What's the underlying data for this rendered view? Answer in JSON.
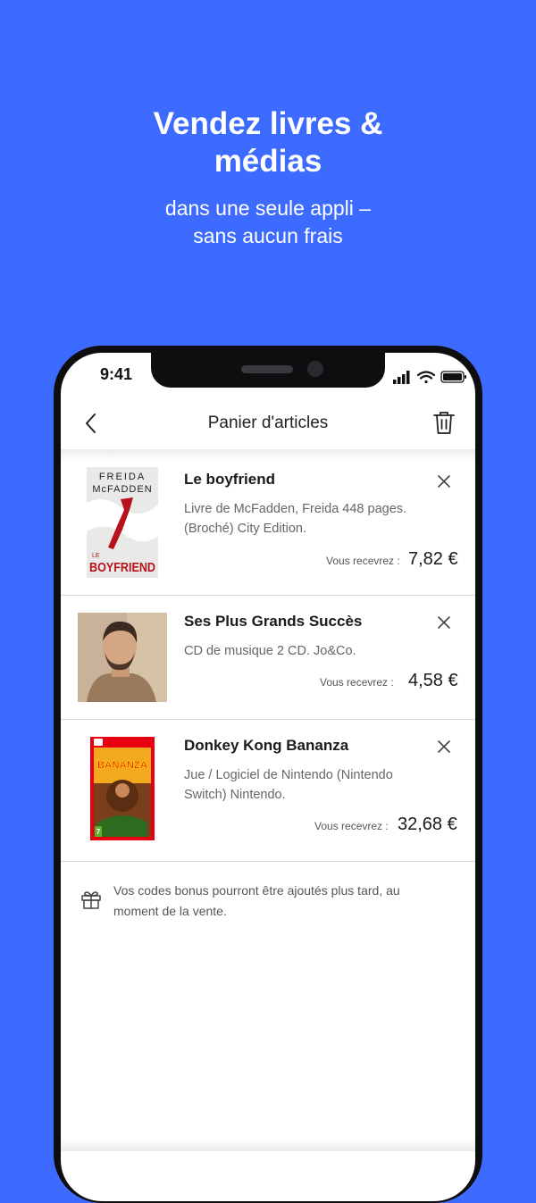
{
  "hero": {
    "title_line1": "Vendez livres &",
    "title_line2": "médias",
    "subtitle_line1": "dans une seule appli –",
    "subtitle_line2": "sans aucun frais"
  },
  "status_bar": {
    "time": "9:41"
  },
  "nav": {
    "title": "Panier d'articles"
  },
  "cart": {
    "receive_label": "Vous recevrez :",
    "items": [
      {
        "title": "Le boyfriend",
        "description": "Livre de McFadden, Freida 448 pages. (Broché) City Edition.",
        "price": "7,82 €",
        "cover": {
          "author_line1": "FREIDA",
          "author_line2": "McFADDEN",
          "title_small": "LE",
          "title_big": "BOYFRIEND"
        }
      },
      {
        "title": "Ses Plus Grands Succès",
        "description": "CD de musique 2 CD. Jo&Co.",
        "price": "4,58 €"
      },
      {
        "title": "Donkey Kong Bananza",
        "description": "Jue / Logiciel de Nintendo (Nintendo Switch) Nintendo.",
        "price": "32,68 €",
        "cover": {
          "game_title": "BANANZA",
          "age_rating": "7"
        }
      }
    ]
  },
  "bonus": {
    "text": "Vos codes bonus pourront être ajoutés plus tard, au moment de la vente."
  },
  "colors": {
    "background": "#3d6bff",
    "phone_frame": "#0e0e10"
  }
}
